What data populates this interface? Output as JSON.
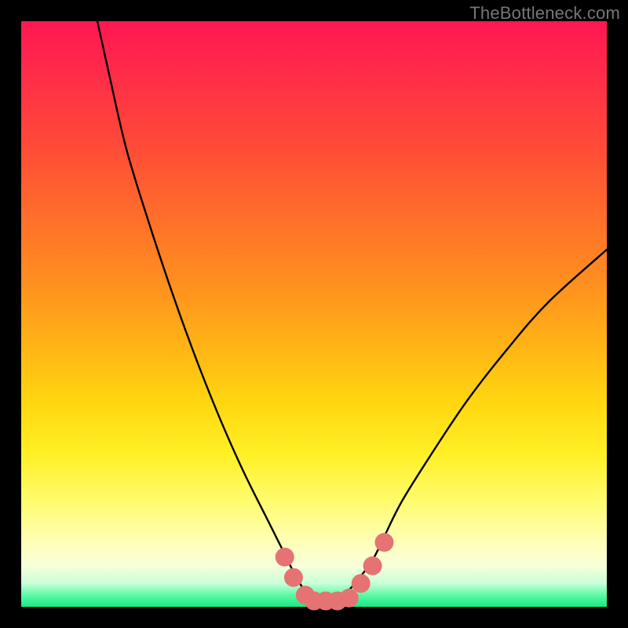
{
  "watermark": "TheBottleneck.com",
  "chart_data": {
    "type": "line",
    "title": "",
    "xlabel": "",
    "ylabel": "",
    "xlim": [
      0,
      100
    ],
    "ylim": [
      0,
      100
    ],
    "series": [
      {
        "name": "bottleneck-curve",
        "x": [
          13,
          15,
          18,
          22,
          26,
          30,
          34,
          38,
          42,
          45,
          47,
          49,
          51,
          53,
          55,
          57,
          60,
          62,
          65,
          70,
          76,
          83,
          90,
          100
        ],
        "values": [
          100,
          91,
          78,
          65,
          53,
          42,
          32,
          23,
          15,
          9,
          5,
          2,
          1,
          1,
          2,
          4,
          8,
          12,
          18,
          26,
          35,
          44,
          52,
          61
        ]
      }
    ],
    "markers": {
      "name": "highlight-dots",
      "color": "#e57373",
      "points": [
        {
          "x": 45.0,
          "y": 8.5,
          "r": 1.6
        },
        {
          "x": 46.5,
          "y": 5.0,
          "r": 1.6
        },
        {
          "x": 48.5,
          "y": 2.0,
          "r": 1.6
        },
        {
          "x": 50.0,
          "y": 1.0,
          "r": 1.6
        },
        {
          "x": 52.0,
          "y": 1.0,
          "r": 1.6
        },
        {
          "x": 54.0,
          "y": 1.0,
          "r": 1.6
        },
        {
          "x": 56.0,
          "y": 1.5,
          "r": 1.6
        },
        {
          "x": 58.0,
          "y": 4.0,
          "r": 1.6
        },
        {
          "x": 60.0,
          "y": 7.0,
          "r": 1.6
        },
        {
          "x": 62.0,
          "y": 11.0,
          "r": 1.6
        }
      ]
    }
  }
}
